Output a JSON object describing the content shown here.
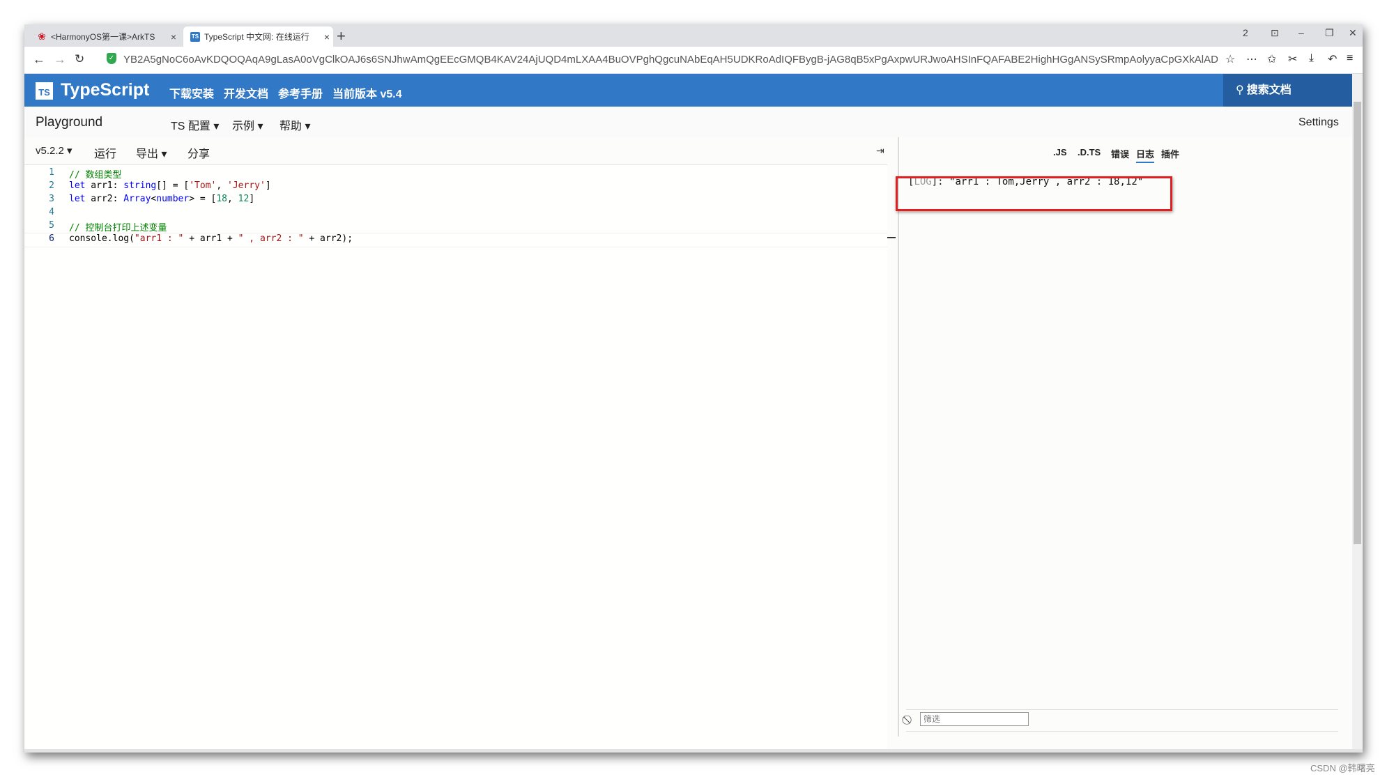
{
  "browser": {
    "tabs": [
      {
        "title": "<HarmonyOS第一课>ArkTS",
        "favicon": "huawei-icon"
      },
      {
        "title": "TypeScript 中文网: 在线运行",
        "favicon": "typescript-icon"
      }
    ],
    "new_tab": "+",
    "window_controls": [
      "2",
      "⊡",
      "–",
      "❐",
      "✕"
    ],
    "url": "YB2A5gNoC6oAvKDQOQAqA9gLasA0oVgClkOAJ6s6SNJhwAmQgEEcGMQB4KAV24AjUQD4mLXAA4BuOVPghQgcuNAbEqAH5UDKRoAdIQFBygB-jAG8qB5xPgAxpwURJwoAHSInFQAFABE2HighHGgANSySRmpAolyyaCpGXkAlADcQA"
  },
  "ts_header": {
    "logo_badge": "TS",
    "logo_text": "TypeScript",
    "nav": [
      "下载安装",
      "开发文档",
      "参考手册",
      "当前版本 v5.4"
    ],
    "search": "搜索文档"
  },
  "playground_nav": {
    "title": "Playground",
    "menus": [
      "TS 配置",
      "示例",
      "帮助"
    ],
    "settings": "Settings"
  },
  "editor_toolbar": {
    "version": "v5.2.2",
    "run": "运行",
    "export": "导出",
    "share": "分享",
    "collapse": "⇥"
  },
  "code": {
    "line_numbers": [
      "1",
      "2",
      "3",
      "4",
      "5",
      "6"
    ],
    "l1": "// 数组类型",
    "l2": {
      "kw": "let",
      "a": " arr1: ",
      "t": "string",
      "b": "[] = [",
      "s1": "'Tom'",
      "c": ", ",
      "s2": "'Jerry'",
      "d": "]"
    },
    "l3": {
      "kw": "let",
      "a": " arr2: ",
      "t": "Array",
      "b": "<",
      "t2": "number",
      "c": "> = [",
      "n1": "18",
      "d": ", ",
      "n2": "12",
      "e": "]"
    },
    "l5": "// 控制台打印上述变量",
    "l6": {
      "a": "console.log(",
      "s1": "\"arr1 : \"",
      "b": " + arr1 + ",
      "s2": "\" , arr2 : \"",
      "c": " + arr2);"
    }
  },
  "output": {
    "tabs": [
      ".JS",
      ".D.TS",
      "错误",
      "日志",
      "插件"
    ],
    "active_tab": "日志",
    "log_level": "LOG",
    "log_message": "\"arr1 : Tom,Jerry , arr2 : 18,12\"",
    "filter_placeholder": "筛选"
  },
  "watermark": "CSDN @韩曙亮",
  "colors": {
    "ts_blue": "#3178c6",
    "highlight_border": "#e02020"
  }
}
